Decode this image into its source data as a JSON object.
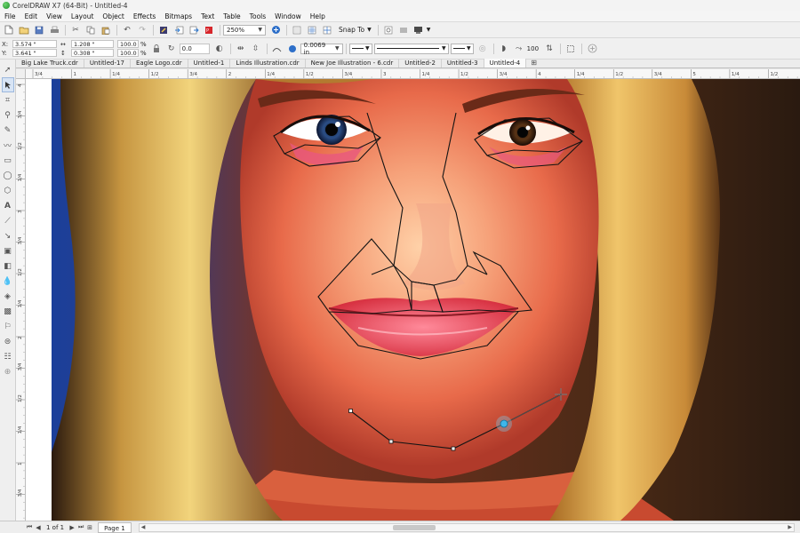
{
  "window": {
    "title": "CorelDRAW X7 (64-Bit) - Untitled-4"
  },
  "menu": [
    "File",
    "Edit",
    "View",
    "Layout",
    "Object",
    "Effects",
    "Bitmaps",
    "Text",
    "Table",
    "Tools",
    "Window",
    "Help"
  ],
  "toolbar": {
    "zoom_value": "250%",
    "snap_label": "Snap To"
  },
  "properties": {
    "x_label": "X:",
    "x_value": "3.574 \"",
    "y_label": "Y:",
    "y_value": "3.641 \"",
    "width_value": "1.208 \"",
    "height_value": "0.308 \"",
    "scale_x": "100.0",
    "scale_y": "100.0",
    "pct": "%",
    "rotation": "0.0",
    "outline_width": "0.0069 in",
    "nudge": "100"
  },
  "tabs": [
    "Big Lake Truck.cdr",
    "Untitled-17",
    "Eagle Logo.cdr",
    "Untitled-1",
    "Linds Illustration.cdr",
    "New Joe Illustration - 6.cdr",
    "Untitled-2",
    "Untitled-3",
    "Untitled-4"
  ],
  "active_tab_index": 8,
  "ruler_h_labels": [
    "3/4",
    "1",
    "1/4",
    "1/2",
    "3/4",
    "2",
    "1/4",
    "1/2",
    "3/4",
    "3",
    "1/4",
    "1/2",
    "3/4",
    "4",
    "1/4",
    "1/2",
    "3/4",
    "5",
    "1/4",
    "1/2"
  ],
  "ruler_v_labels": [
    "4",
    "3/4",
    "1/2",
    "1/4",
    "3",
    "3/4",
    "1/2",
    "1/4",
    "2",
    "3/4",
    "1/2",
    "1/4",
    "1",
    "3/4"
  ],
  "status": {
    "page_count": "1 of 1",
    "page_tab": "Page 1"
  },
  "colors": {
    "accent": "#1f9ad6",
    "node_selected": "#3fb6e8"
  },
  "icons": {
    "toolbar": [
      "new-icon",
      "open-icon",
      "save-icon",
      "print-icon",
      "cut-icon",
      "copy-icon",
      "paste-icon",
      "undo-icon",
      "redo-icon",
      "search-content-icon",
      "import-icon",
      "export-icon",
      "publish-pdf-icon",
      "launcher-icon",
      "full-screen-icon",
      "rulers-icon",
      "grid-icon",
      "guidelines-icon",
      "options-icon",
      "app-launcher-icon"
    ],
    "toolbox": [
      "pick-tool-icon",
      "shape-tool-icon",
      "crop-tool-icon",
      "zoom-tool-icon",
      "freehand-tool-icon",
      "artistic-media-icon",
      "rectangle-tool-icon",
      "ellipse-tool-icon",
      "polygon-tool-icon",
      "text-tool-icon",
      "parallel-dimension-icon",
      "connector-tool-icon",
      "drop-shadow-icon",
      "transparency-icon",
      "eyedropper-icon",
      "interactive-fill-icon",
      "smart-fill-icon",
      "outline-pen-icon",
      "contour-icon",
      "table-tool-icon",
      "add-tool-icon"
    ]
  }
}
